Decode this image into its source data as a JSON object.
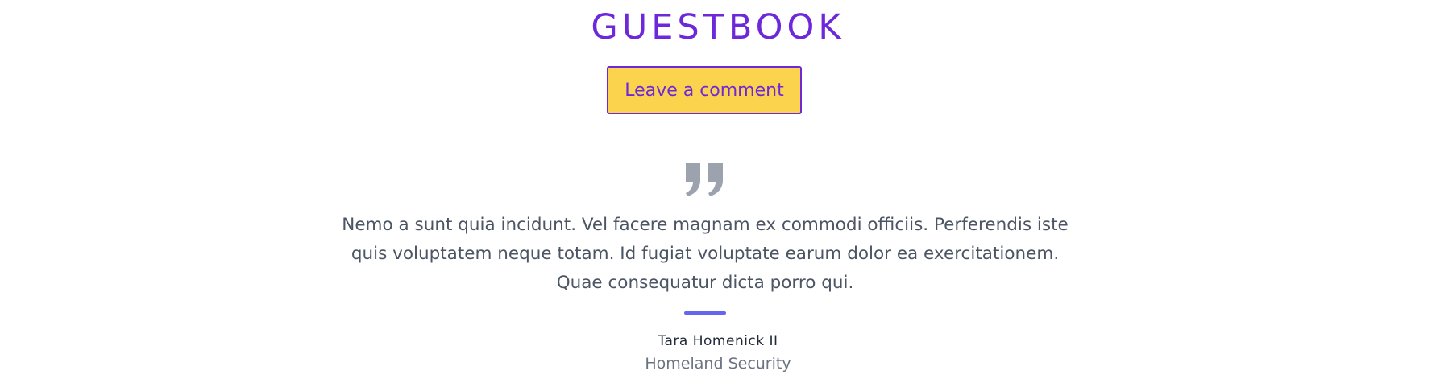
{
  "header": {
    "title": "GUESTBOOK"
  },
  "actions": {
    "comment_label": "Leave a comment"
  },
  "testimonial": {
    "quote_icon": "quote-icon",
    "text": "Nemo a sunt quia incidunt. Vel facere magnam ex commodi officiis. Perferendis iste quis voluptatem neque totam. Id fugiat voluptate earum dolor ea exercitationem. Quae consequatur dicta porro qui.",
    "author": "Tara Homenick II",
    "role": "Homeland Security"
  },
  "colors": {
    "accent": "#6d28d9",
    "button_bg": "#fcd34d",
    "divider": "#6366f1",
    "icon": "#9ca3af"
  }
}
